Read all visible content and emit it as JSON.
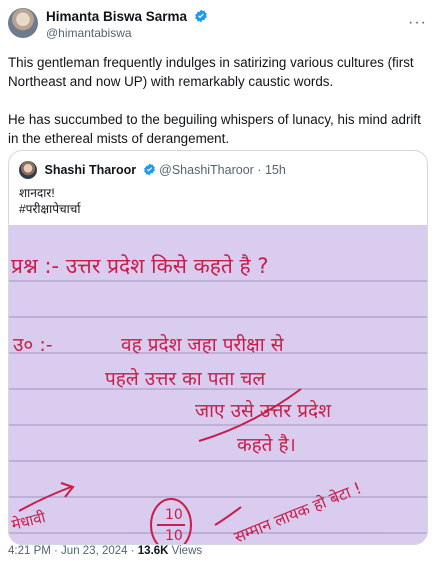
{
  "author": {
    "name": "Himanta Biswa Sarma",
    "handle": "@himantabiswa"
  },
  "tweet": {
    "paragraphs": [
      "This gentleman frequently indulges in satirizing various cultures (first Northeast and now UP) with remarkably caustic words.",
      "He has succumbed to the beguiling whispers of lunacy, his mind adrift in the ethereal mists of derangement."
    ]
  },
  "quoted": {
    "name": "Shashi Tharoor",
    "handle": "@ShashiTharoor",
    "time": "· 15h",
    "lines": [
      "शानदार!",
      "#परीक्षापेचार्चा"
    ]
  },
  "handwriting": {
    "question": "प्रश्न :-  उत्तर प्रदेश किसे कहते है ?",
    "answer_label": "उ० :-",
    "answer_line1": "वह प्रदेश जहा परीक्षा से",
    "answer_line2": "पहले उत्तर का पता चल",
    "answer_line3": "जाए उसे उत्तर प्रदेश",
    "answer_line4": "कहते है।",
    "score_top": "10",
    "score_bottom": "10",
    "remark_left": "मेधावी",
    "remark_right": "सम्मान लायक हो बेटा !"
  },
  "meta": {
    "time": "4:21 PM · Jun 23, 2024 · ",
    "views": "13.6K",
    "views_label": " Views"
  },
  "colors": {
    "verified": "#1d9bf0",
    "ink_red": "#c81d4a",
    "paper": "#d9ccee",
    "lines": "#8a7fa6"
  }
}
